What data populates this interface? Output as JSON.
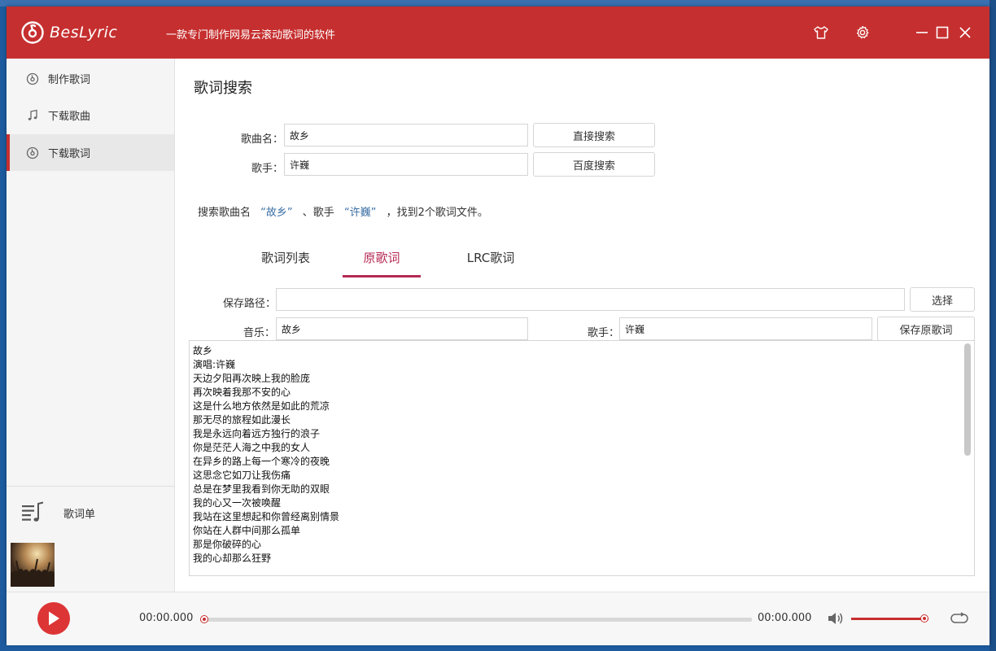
{
  "app": {
    "name": "BesLyric",
    "tagline": "一款专门制作网易云滚动歌词的软件"
  },
  "sidebar": {
    "items": [
      {
        "label": "制作歌词",
        "icon": "make-lyrics-icon"
      },
      {
        "label": "下载歌曲",
        "icon": "music-note-icon"
      },
      {
        "label": "下载歌词",
        "icon": "download-lyrics-icon"
      }
    ],
    "active_index": 2,
    "playlist_label": "歌词单"
  },
  "search": {
    "title": "歌词搜索",
    "song_label": "歌曲名：",
    "song_value": "故乡",
    "artist_label": "歌手：",
    "artist_value": "许巍",
    "direct_search_label": "直接搜索",
    "baidu_search_label": "百度搜索",
    "result": {
      "prefix": "搜索歌曲名",
      "song": "“故乡”",
      "mid": "、歌手",
      "artist": "“许巍”",
      "suffix": "，找到2个歌词文件。"
    }
  },
  "tabs": [
    {
      "label": "歌词列表"
    },
    {
      "label": "原歌词"
    },
    {
      "label": "LRC歌词"
    }
  ],
  "active_tab": 1,
  "detail": {
    "save_path_label": "保存路径：",
    "save_path_value": "",
    "choose_label": "选择",
    "music_label": "音乐：",
    "music_value": "故乡",
    "artist_label": "歌手：",
    "artist_value": "许巍",
    "save_original_label": "保存原歌词"
  },
  "lyrics": "故乡\n演唱:许巍\n天边夕阳再次映上我的脸庞\n再次映着我那不安的心\n这是什么地方依然是如此的荒凉\n那无尽的旅程如此漫长\n我是永远向着远方独行的浪子\n你是茫茫人海之中我的女人\n在异乡的路上每一个寒冷的夜晚\n这思念它如刀让我伤痛\n总是在梦里我看到你无助的双眼\n我的心又一次被唤醒\n我站在这里想起和你曾经离别情景\n你站在人群中间那么孤单\n那是你破碎的心\n我的心却那么狂野",
  "player": {
    "current_time": "00:00.000",
    "total_time": "00:00.000",
    "progress": 0,
    "volume": 1.0
  },
  "colors": {
    "primary": "#c62f2f",
    "tab_active": "#b52a55",
    "play_button": "#dd3535"
  }
}
